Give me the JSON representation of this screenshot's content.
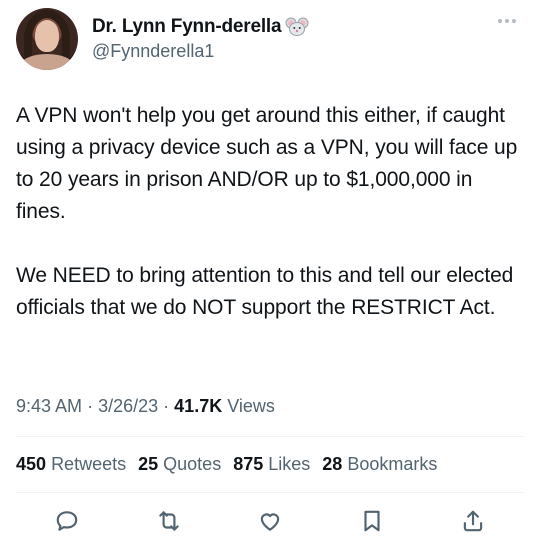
{
  "author": {
    "display_name": "Dr. Lynn Fynn-derella",
    "handle": "@Fynnderella1",
    "emoji": "mouse-face-icon"
  },
  "tweet": {
    "text": "A VPN won't help you get around this either, if caught using a privacy device such as a VPN, you will face up to 20 years in prison AND/OR up to $1,000,000 in fines.\n\nWe NEED to bring attention to this and tell our elected officials that we do NOT support the RESTRICT Act."
  },
  "meta": {
    "time": "9:43 AM",
    "sep1": "·",
    "date": "3/26/23",
    "sep2": "·",
    "views_count": "41.7K",
    "views_label": "Views"
  },
  "stats": {
    "retweets_count": "450",
    "retweets_label": "Retweets",
    "quotes_count": "25",
    "quotes_label": "Quotes",
    "likes_count": "875",
    "likes_label": "Likes",
    "bookmarks_count": "28",
    "bookmarks_label": "Bookmarks"
  },
  "colors": {
    "text": "#0f1419",
    "secondary": "#536471",
    "divider": "#eff3f4"
  }
}
